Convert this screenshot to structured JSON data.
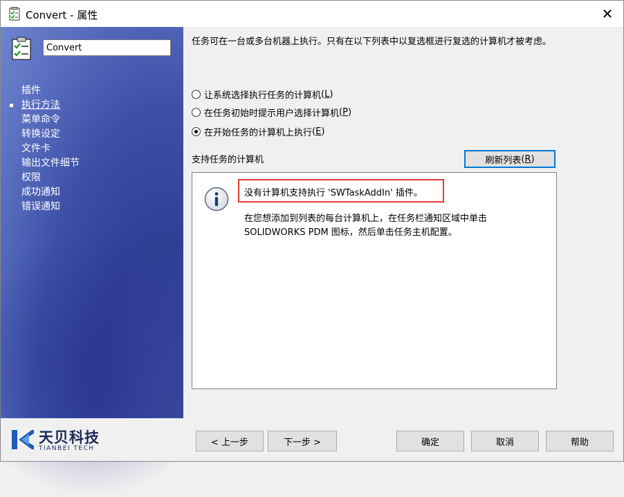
{
  "window": {
    "title": "Convert - 属性",
    "close_label": "✕"
  },
  "sidebar": {
    "task_name": "Convert",
    "items": [
      {
        "label": "插件",
        "active": false
      },
      {
        "label": "执行方法",
        "active": true
      },
      {
        "label": "菜单命令",
        "active": false
      },
      {
        "label": "转换设定",
        "active": false
      },
      {
        "label": "文件卡",
        "active": false
      },
      {
        "label": "输出文件细节",
        "active": false
      },
      {
        "label": "权限",
        "active": false
      },
      {
        "label": "成功通知",
        "active": false
      },
      {
        "label": "错误通知",
        "active": false
      }
    ]
  },
  "main": {
    "intro_text": "任务可在一台或多台机器上执行。只有在以下列表中以复选框进行复选的计算机才被考虑。",
    "options": [
      {
        "label": "让系统选择执行任务的计算机",
        "key": "L",
        "checked": false
      },
      {
        "label": "在任务初始时提示用户选择计算机",
        "key": "P",
        "checked": false
      },
      {
        "label": "在开始任务的计算机上执行",
        "key": "E",
        "checked": true
      }
    ],
    "section_label": "支持任务的计算机",
    "refresh_label": "刷新列表",
    "refresh_key": "R",
    "message_title": "没有计算机支持执行 'SWTaskAddIn' 插件。",
    "message_body_line1": "在您想添加到列表的每台计算机上，在任务栏通知区域中单击",
    "message_body_line2": "SOLIDWORKS PDM 图标，然后单击任务主机配置。"
  },
  "footer": {
    "logo_cn": "天贝科技",
    "logo_en": "TIANBEI TECH",
    "prev_label": "< 上一步",
    "next_label": "下一步 >",
    "ok_label": "确定",
    "cancel_label": "取消",
    "help_label": "帮助"
  },
  "colors": {
    "accent": "#0078d7",
    "highlight": "#e53935",
    "sidebar": "#3d4fa6"
  }
}
